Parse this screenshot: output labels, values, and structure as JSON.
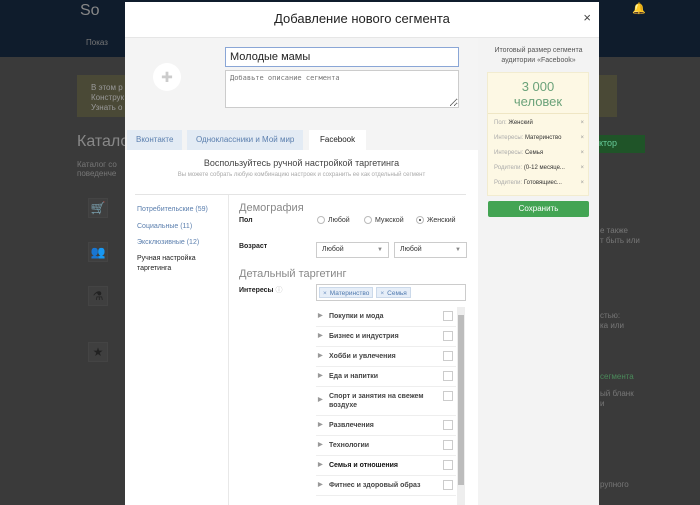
{
  "background": {
    "logo": "So",
    "nav": "Показ",
    "notice": [
      "В этом р",
      "Конструк",
      "Узнать о"
    ],
    "catalog_title": "Катало",
    "catalog_desc": [
      "Каталог со",
      "поведенче"
    ],
    "constructor_button": "нструктор",
    "right_fragments": [
      "е также",
      "т быть или",
      "стью:",
      "ка или",
      "сегмента",
      "ый бланк",
      "и",
      "рупного"
    ]
  },
  "modal": {
    "title": "Добавление нового сегмента",
    "close": "×",
    "name_value": "Молодые мамы",
    "description_placeholder": "Добавьте описание сегмента",
    "tabs": [
      {
        "label": "Вконтакте",
        "active": false
      },
      {
        "label": "Одноклассники и Мой мир",
        "active": false
      },
      {
        "label": "Facebook",
        "active": true
      }
    ],
    "headline": "Воспользуйтесь ручной настройкой таргетинга",
    "subline": "Вы можете собрать любую комбинацию настроек и сохранить ее как отдельный сегмент",
    "nav": [
      "Потребительские (59)",
      "Социальные (11)",
      "Эксклюзивные (12)",
      "Ручная настройка таргетинга"
    ],
    "demography": "Демография",
    "gender_label": "Пол",
    "gender_options": [
      "Любой",
      "Мужской",
      "Женский"
    ],
    "gender_selected": "Женский",
    "age_label": "Возраст",
    "age_from": "Любой",
    "age_to": "Любой",
    "detailed": "Детальный таргетинг",
    "interests_label": "Интересы",
    "interest_tags": [
      "Материнство",
      "Семья"
    ],
    "categories": [
      "Покупки и мода",
      "Бизнес и индустрия",
      "Хобби и увлечения",
      "Еда и напитки",
      "Спорт и занятия на свежем воздухе",
      "Развлечения",
      "Технологии",
      "Семья и отношения",
      "Фитнес и здоровый образ"
    ]
  },
  "summary": {
    "title": "Итоговый размер сегмента аудитории «Facebook»",
    "count": "3 000",
    "unit": "человек",
    "items": [
      {
        "k": "Пол:",
        "v": "Женский"
      },
      {
        "k": "Интересы:",
        "v": "Материнство"
      },
      {
        "k": "Интересы:",
        "v": "Семья"
      },
      {
        "k": "Родители:",
        "v": "(0-12 месяце..."
      },
      {
        "k": "Родители:",
        "v": "Готовящиес..."
      }
    ],
    "save": "Сохранить",
    "accent": "#43a453"
  }
}
